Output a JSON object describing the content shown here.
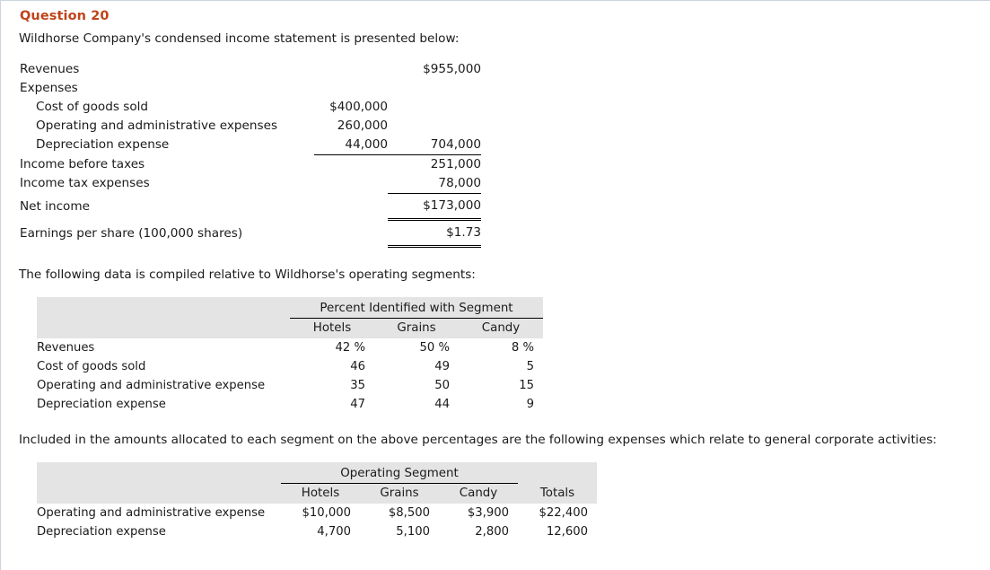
{
  "question": {
    "title": "Question 20",
    "intro": "Wildhorse Company's condensed income statement is presented below:",
    "mid_text": "The following data is compiled relative to Wildhorse's operating segments:",
    "lower_text": "Included in the amounts allocated to each segment on the above percentages are the following expenses which relate to general corporate activities:"
  },
  "colors": {
    "title": "#c0441a",
    "table_header_bg": "#e4e4e4",
    "page_border": "#ccd4e0",
    "text": "#1a1a1a"
  },
  "income_statement": {
    "rows": [
      {
        "label": "Revenues",
        "indent": false,
        "c1": "",
        "c2": "$955,000"
      },
      {
        "label": "Expenses",
        "indent": false,
        "c1": "",
        "c2": ""
      },
      {
        "label": "Cost of goods sold",
        "indent": true,
        "c1": "$400,000",
        "c2": ""
      },
      {
        "label": "Operating and administrative expenses",
        "indent": true,
        "c1": "260,000",
        "c2": ""
      },
      {
        "label": "Depreciation expense",
        "indent": true,
        "c1": "44,000",
        "c2": "704,000"
      },
      {
        "label": "Income before taxes",
        "indent": false,
        "c1": "",
        "c2": "251,000"
      },
      {
        "label": "Income tax expenses",
        "indent": false,
        "c1": "",
        "c2": "78,000"
      },
      {
        "label": "Net income",
        "indent": false,
        "c1": "",
        "c2": "$173,000"
      },
      {
        "label": "Earnings per share (100,000 shares)",
        "indent": false,
        "c1": "",
        "c2": "$1.73"
      }
    ]
  },
  "segment_percent_table": {
    "group_header": "Percent Identified with Segment",
    "columns": [
      "Hotels",
      "Grains",
      "Candy"
    ],
    "rows": [
      {
        "label": "Revenues",
        "values": [
          "42 %",
          "50 %",
          "8 %"
        ]
      },
      {
        "label": "Cost of goods sold",
        "values": [
          "46",
          "49",
          "5"
        ]
      },
      {
        "label": "Operating and administrative expense",
        "values": [
          "35",
          "50",
          "15"
        ]
      },
      {
        "label": "Depreciation expense",
        "values": [
          "47",
          "44",
          "9"
        ]
      }
    ]
  },
  "corporate_expense_table": {
    "group_header": "Operating Segment",
    "columns": [
      "Hotels",
      "Grains",
      "Candy",
      "Totals"
    ],
    "rows": [
      {
        "label": "Operating and administrative expense",
        "values": [
          "$10,000",
          "$8,500",
          "$3,900",
          "$22,400"
        ]
      },
      {
        "label": "Depreciation expense",
        "values": [
          "4,700",
          "5,100",
          "2,800",
          "12,600"
        ]
      }
    ]
  }
}
